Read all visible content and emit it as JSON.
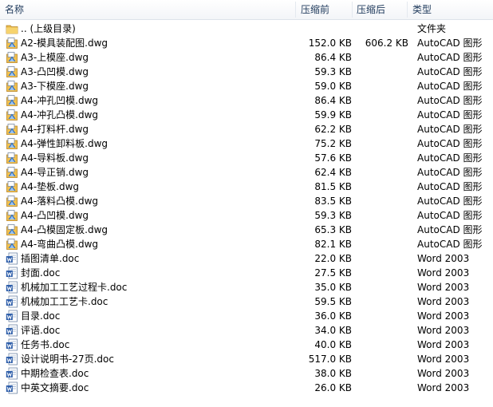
{
  "columns": {
    "name": "名称",
    "compressed": "压缩前",
    "original": "压缩后",
    "type": "类型"
  },
  "files": [
    {
      "name": ".. (上级目录)",
      "compressed": "",
      "original": "",
      "type": "文件夹",
      "icon": "folder-icon"
    },
    {
      "name": "A2-模具装配图.dwg",
      "compressed": "152.0 KB",
      "original": "606.2 KB",
      "type": "AutoCAD 图形",
      "icon": "autocad-file-icon"
    },
    {
      "name": "A3-上模座.dwg",
      "compressed": "86.4 KB",
      "original": "",
      "type": "AutoCAD 图形",
      "icon": "autocad-file-icon"
    },
    {
      "name": "A3-凸凹模.dwg",
      "compressed": "59.3 KB",
      "original": "",
      "type": "AutoCAD 图形",
      "icon": "autocad-file-icon"
    },
    {
      "name": "A3-下模座.dwg",
      "compressed": "59.0 KB",
      "original": "",
      "type": "AutoCAD 图形",
      "icon": "autocad-file-icon"
    },
    {
      "name": "A4-冲孔凹模.dwg",
      "compressed": "86.4 KB",
      "original": "",
      "type": "AutoCAD 图形",
      "icon": "autocad-file-icon"
    },
    {
      "name": "A4-冲孔凸模.dwg",
      "compressed": "59.9 KB",
      "original": "",
      "type": "AutoCAD 图形",
      "icon": "autocad-file-icon"
    },
    {
      "name": "A4-打料杆.dwg",
      "compressed": "62.2 KB",
      "original": "",
      "type": "AutoCAD 图形",
      "icon": "autocad-file-icon"
    },
    {
      "name": "A4-弹性卸料板.dwg",
      "compressed": "75.2 KB",
      "original": "",
      "type": "AutoCAD 图形",
      "icon": "autocad-file-icon"
    },
    {
      "name": "A4-导料板.dwg",
      "compressed": "57.6 KB",
      "original": "",
      "type": "AutoCAD 图形",
      "icon": "autocad-file-icon"
    },
    {
      "name": "A4-导正销.dwg",
      "compressed": "62.4 KB",
      "original": "",
      "type": "AutoCAD 图形",
      "icon": "autocad-file-icon"
    },
    {
      "name": "A4-垫板.dwg",
      "compressed": "81.5 KB",
      "original": "",
      "type": "AutoCAD 图形",
      "icon": "autocad-file-icon"
    },
    {
      "name": "A4-落料凸模.dwg",
      "compressed": "83.5 KB",
      "original": "",
      "type": "AutoCAD 图形",
      "icon": "autocad-file-icon"
    },
    {
      "name": "A4-凸凹模.dwg",
      "compressed": "59.3 KB",
      "original": "",
      "type": "AutoCAD 图形",
      "icon": "autocad-file-icon"
    },
    {
      "name": "A4-凸模固定板.dwg",
      "compressed": "65.3 KB",
      "original": "",
      "type": "AutoCAD 图形",
      "icon": "autocad-file-icon"
    },
    {
      "name": "A4-弯曲凸模.dwg",
      "compressed": "82.1 KB",
      "original": "",
      "type": "AutoCAD 图形",
      "icon": "autocad-file-icon"
    },
    {
      "name": "插图清单.doc",
      "compressed": "22.0 KB",
      "original": "",
      "type": "Word 2003",
      "icon": "word-file-icon"
    },
    {
      "name": "封面.doc",
      "compressed": "27.5 KB",
      "original": "",
      "type": "Word 2003",
      "icon": "word-file-icon"
    },
    {
      "name": "机械加工工艺过程卡.doc",
      "compressed": "35.0 KB",
      "original": "",
      "type": "Word 2003",
      "icon": "word-file-icon"
    },
    {
      "name": "机械加工工艺卡.doc",
      "compressed": "59.5 KB",
      "original": "",
      "type": "Word 2003",
      "icon": "word-file-icon"
    },
    {
      "name": "目录.doc",
      "compressed": "36.0 KB",
      "original": "",
      "type": "Word 2003",
      "icon": "word-file-icon"
    },
    {
      "name": "评语.doc",
      "compressed": "34.0 KB",
      "original": "",
      "type": "Word 2003",
      "icon": "word-file-icon"
    },
    {
      "name": "任务书.doc",
      "compressed": "40.0 KB",
      "original": "",
      "type": "Word 2003",
      "icon": "word-file-icon"
    },
    {
      "name": "设计说明书-27页.doc",
      "compressed": "517.0 KB",
      "original": "",
      "type": "Word 2003",
      "icon": "word-file-icon"
    },
    {
      "name": "中期检查表.doc",
      "compressed": "38.0 KB",
      "original": "",
      "type": "Word 2003",
      "icon": "word-file-icon"
    },
    {
      "name": "中英文摘要.doc",
      "compressed": "26.0 KB",
      "original": "",
      "type": "Word 2003",
      "icon": "word-file-icon"
    }
  ]
}
